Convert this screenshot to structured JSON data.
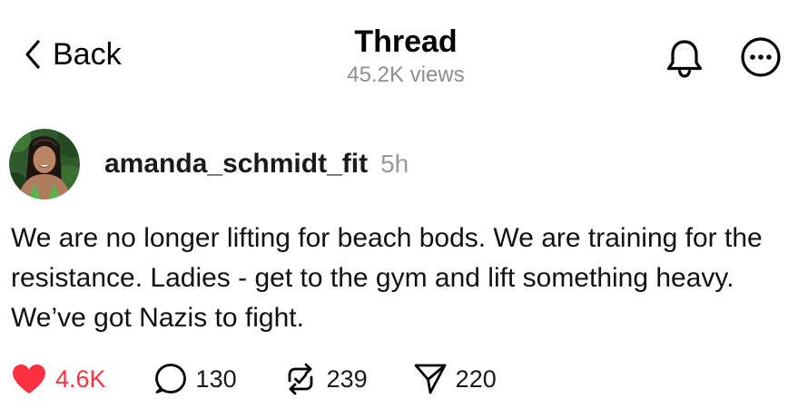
{
  "header": {
    "back_label": "Back",
    "title": "Thread",
    "views": "45.2K views"
  },
  "icons": {
    "back": "chevron-left-icon",
    "notifications": "bell-icon",
    "more": "more-options-icon",
    "like": "heart-icon",
    "reply": "comment-icon",
    "repost": "repost-icon",
    "share": "send-icon"
  },
  "post": {
    "username": "amanda_schmidt_fit",
    "timestamp": "5h",
    "text": "We are no longer lifting for beach bods. We are training for the resistance. Ladies - get to the gym and lift something heavy. We’ve got Nazis to fight.",
    "likes": "4.6K",
    "replies": "130",
    "reposts": "239",
    "shares": "220",
    "liked": true
  },
  "colors": {
    "like_active": "#ff3040",
    "muted_text": "#8e8e8e",
    "text": "#111111"
  }
}
